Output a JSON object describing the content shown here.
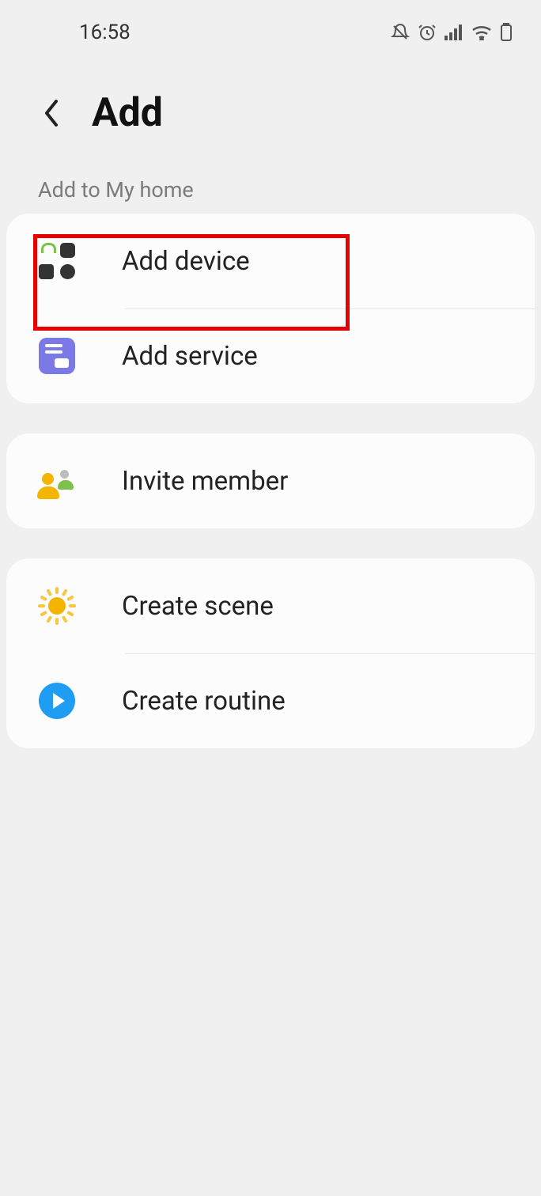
{
  "status": {
    "time": "16:58"
  },
  "header": {
    "title": "Add"
  },
  "section_label": "Add to My home",
  "groups": [
    {
      "items": [
        {
          "key": "add_device",
          "label": "Add device"
        },
        {
          "key": "add_service",
          "label": "Add service"
        }
      ]
    },
    {
      "items": [
        {
          "key": "invite_member",
          "label": "Invite member"
        }
      ]
    },
    {
      "items": [
        {
          "key": "create_scene",
          "label": "Create scene"
        },
        {
          "key": "create_routine",
          "label": "Create routine"
        }
      ]
    }
  ],
  "highlighted_item_key": "add_device"
}
